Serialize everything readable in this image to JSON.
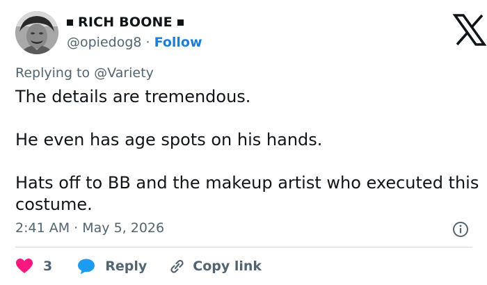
{
  "author": {
    "display_name": "RICH BOONE",
    "handle": "@opiedog8",
    "separator": "·",
    "follow_label": "Follow",
    "avatar_icon": "person-photo-avatar"
  },
  "brand": {
    "logo_icon": "x-logo-icon"
  },
  "reply_context": {
    "prefix": "Replying to",
    "mention": "@Variety"
  },
  "tweet": {
    "paragraphs": [
      "The details are tremendous.",
      "He even has age spots on his hands.",
      "Hats off to BB and the makeup artist who executed this costume."
    ],
    "time": "2:41 AM",
    "separator": "·",
    "date": "May 5, 2026"
  },
  "actions": {
    "like_count": "3",
    "reply_label": "Reply",
    "copy_label": "Copy link"
  },
  "colors": {
    "text": "#0f1419",
    "muted": "#536471",
    "link": "#1d7ed8",
    "like": "#f91880",
    "reply": "#1d9bf0",
    "divider": "#cfd9de"
  }
}
